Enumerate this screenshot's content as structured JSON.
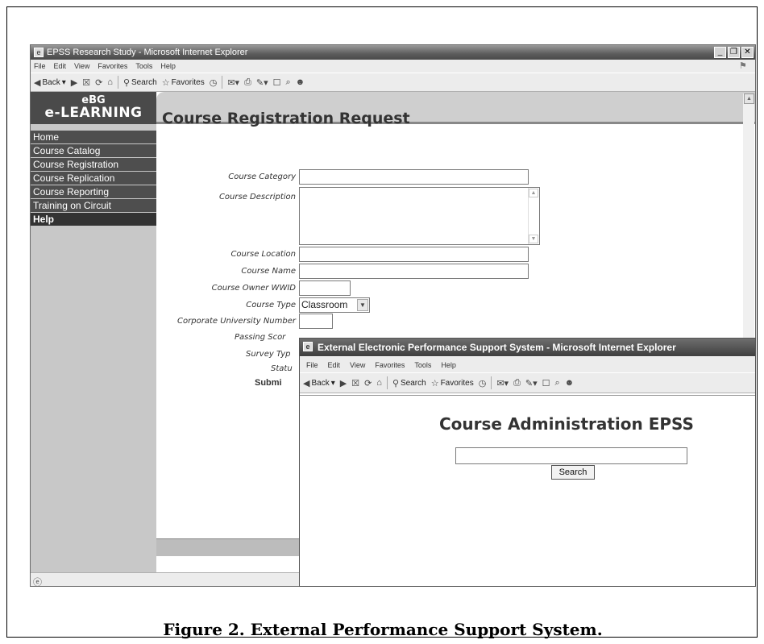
{
  "main_window": {
    "title": "EPSS Research Study - Microsoft Internet Explorer",
    "menu": [
      "File",
      "Edit",
      "View",
      "Favorites",
      "Tools",
      "Help"
    ],
    "toolbar": {
      "back": "Back",
      "search": "Search",
      "favorites": "Favorites"
    },
    "logo": {
      "line1": "eBG",
      "line2": "e-LEARNING"
    },
    "nav": [
      "Home",
      "Course Catalog",
      "Course Registration",
      "Course Replication",
      "Course Reporting",
      "Training on Circuit",
      "Help"
    ],
    "page_title": "Course Registration Request",
    "form": {
      "labels": {
        "category": "Course Category",
        "description": "Course Description",
        "location": "Course Location",
        "name": "Course Name",
        "owner": "Course Owner WWID",
        "type": "Course Type",
        "corp_number": "Corporate University Number",
        "passing": "Passing Scor",
        "survey": "Survey Typ",
        "status": "Statu",
        "submit": "Submi"
      },
      "type_value": "Classroom"
    }
  },
  "popup_window": {
    "title": "External Electronic Performance Support System - Microsoft Internet Explorer",
    "menu": [
      "File",
      "Edit",
      "View",
      "Favorites",
      "Tools",
      "Help"
    ],
    "toolbar": {
      "back": "Back",
      "search": "Search",
      "favorites": "Favorites"
    },
    "heading": "Course Administration EPSS",
    "search_button": "Search",
    "search_value": ""
  },
  "caption": "Figure 2. External Performance Support System."
}
